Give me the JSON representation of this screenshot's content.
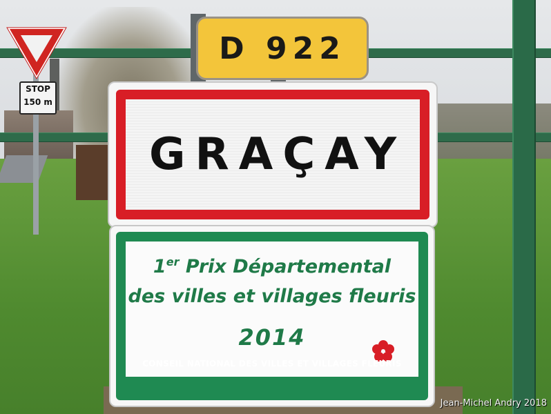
{
  "scene": {
    "route_sign": {
      "text": "D 922"
    },
    "town_sign": {
      "name": "GRAÇAY"
    },
    "award_sign": {
      "rank_number": "1",
      "rank_suffix": "er",
      "line1_rest": " Prix Départemental",
      "line2": "des villes et villages fleuris",
      "year": "2014",
      "footer": "CONSEIL NATIONAL DES VILLES ET VILLAGES FLEURIS"
    },
    "stop_sign": {
      "line1": "STOP",
      "line2": "150 m"
    },
    "photo_credit": "Jean-Michel Andry 2018"
  },
  "colors": {
    "route_yellow": "#f3c53a",
    "town_border_red": "#d81e26",
    "award_green": "#1f8a52",
    "fence_green": "#2e6b4a",
    "flower_red": "#d81e26"
  }
}
